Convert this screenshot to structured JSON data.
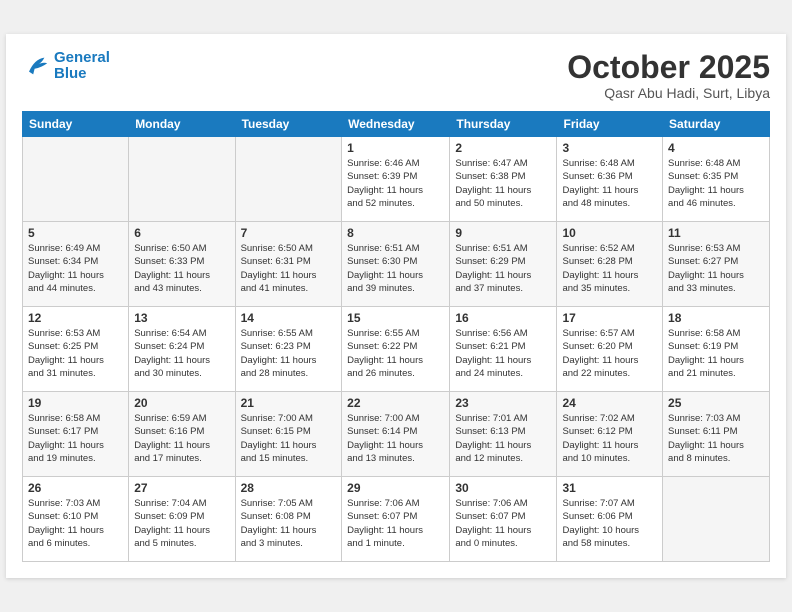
{
  "header": {
    "logo_line1": "General",
    "logo_line2": "Blue",
    "month_title": "October 2025",
    "subtitle": "Qasr Abu Hadi, Surt, Libya"
  },
  "days_of_week": [
    "Sunday",
    "Monday",
    "Tuesday",
    "Wednesday",
    "Thursday",
    "Friday",
    "Saturday"
  ],
  "weeks": [
    [
      {
        "num": "",
        "info": ""
      },
      {
        "num": "",
        "info": ""
      },
      {
        "num": "",
        "info": ""
      },
      {
        "num": "1",
        "info": "Sunrise: 6:46 AM\nSunset: 6:39 PM\nDaylight: 11 hours\nand 52 minutes."
      },
      {
        "num": "2",
        "info": "Sunrise: 6:47 AM\nSunset: 6:38 PM\nDaylight: 11 hours\nand 50 minutes."
      },
      {
        "num": "3",
        "info": "Sunrise: 6:48 AM\nSunset: 6:36 PM\nDaylight: 11 hours\nand 48 minutes."
      },
      {
        "num": "4",
        "info": "Sunrise: 6:48 AM\nSunset: 6:35 PM\nDaylight: 11 hours\nand 46 minutes."
      }
    ],
    [
      {
        "num": "5",
        "info": "Sunrise: 6:49 AM\nSunset: 6:34 PM\nDaylight: 11 hours\nand 44 minutes."
      },
      {
        "num": "6",
        "info": "Sunrise: 6:50 AM\nSunset: 6:33 PM\nDaylight: 11 hours\nand 43 minutes."
      },
      {
        "num": "7",
        "info": "Sunrise: 6:50 AM\nSunset: 6:31 PM\nDaylight: 11 hours\nand 41 minutes."
      },
      {
        "num": "8",
        "info": "Sunrise: 6:51 AM\nSunset: 6:30 PM\nDaylight: 11 hours\nand 39 minutes."
      },
      {
        "num": "9",
        "info": "Sunrise: 6:51 AM\nSunset: 6:29 PM\nDaylight: 11 hours\nand 37 minutes."
      },
      {
        "num": "10",
        "info": "Sunrise: 6:52 AM\nSunset: 6:28 PM\nDaylight: 11 hours\nand 35 minutes."
      },
      {
        "num": "11",
        "info": "Sunrise: 6:53 AM\nSunset: 6:27 PM\nDaylight: 11 hours\nand 33 minutes."
      }
    ],
    [
      {
        "num": "12",
        "info": "Sunrise: 6:53 AM\nSunset: 6:25 PM\nDaylight: 11 hours\nand 31 minutes."
      },
      {
        "num": "13",
        "info": "Sunrise: 6:54 AM\nSunset: 6:24 PM\nDaylight: 11 hours\nand 30 minutes."
      },
      {
        "num": "14",
        "info": "Sunrise: 6:55 AM\nSunset: 6:23 PM\nDaylight: 11 hours\nand 28 minutes."
      },
      {
        "num": "15",
        "info": "Sunrise: 6:55 AM\nSunset: 6:22 PM\nDaylight: 11 hours\nand 26 minutes."
      },
      {
        "num": "16",
        "info": "Sunrise: 6:56 AM\nSunset: 6:21 PM\nDaylight: 11 hours\nand 24 minutes."
      },
      {
        "num": "17",
        "info": "Sunrise: 6:57 AM\nSunset: 6:20 PM\nDaylight: 11 hours\nand 22 minutes."
      },
      {
        "num": "18",
        "info": "Sunrise: 6:58 AM\nSunset: 6:19 PM\nDaylight: 11 hours\nand 21 minutes."
      }
    ],
    [
      {
        "num": "19",
        "info": "Sunrise: 6:58 AM\nSunset: 6:17 PM\nDaylight: 11 hours\nand 19 minutes."
      },
      {
        "num": "20",
        "info": "Sunrise: 6:59 AM\nSunset: 6:16 PM\nDaylight: 11 hours\nand 17 minutes."
      },
      {
        "num": "21",
        "info": "Sunrise: 7:00 AM\nSunset: 6:15 PM\nDaylight: 11 hours\nand 15 minutes."
      },
      {
        "num": "22",
        "info": "Sunrise: 7:00 AM\nSunset: 6:14 PM\nDaylight: 11 hours\nand 13 minutes."
      },
      {
        "num": "23",
        "info": "Sunrise: 7:01 AM\nSunset: 6:13 PM\nDaylight: 11 hours\nand 12 minutes."
      },
      {
        "num": "24",
        "info": "Sunrise: 7:02 AM\nSunset: 6:12 PM\nDaylight: 11 hours\nand 10 minutes."
      },
      {
        "num": "25",
        "info": "Sunrise: 7:03 AM\nSunset: 6:11 PM\nDaylight: 11 hours\nand 8 minutes."
      }
    ],
    [
      {
        "num": "26",
        "info": "Sunrise: 7:03 AM\nSunset: 6:10 PM\nDaylight: 11 hours\nand 6 minutes."
      },
      {
        "num": "27",
        "info": "Sunrise: 7:04 AM\nSunset: 6:09 PM\nDaylight: 11 hours\nand 5 minutes."
      },
      {
        "num": "28",
        "info": "Sunrise: 7:05 AM\nSunset: 6:08 PM\nDaylight: 11 hours\nand 3 minutes."
      },
      {
        "num": "29",
        "info": "Sunrise: 7:06 AM\nSunset: 6:07 PM\nDaylight: 11 hours\nand 1 minute."
      },
      {
        "num": "30",
        "info": "Sunrise: 7:06 AM\nSunset: 6:07 PM\nDaylight: 11 hours\nand 0 minutes."
      },
      {
        "num": "31",
        "info": "Sunrise: 7:07 AM\nSunset: 6:06 PM\nDaylight: 10 hours\nand 58 minutes."
      },
      {
        "num": "",
        "info": ""
      }
    ]
  ]
}
